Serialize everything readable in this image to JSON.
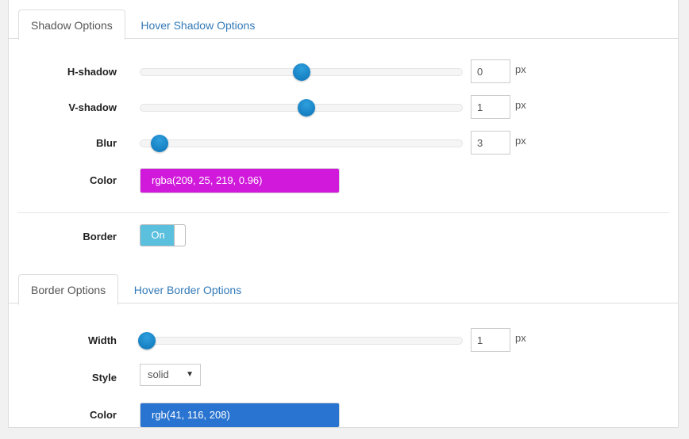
{
  "shadow_section": {
    "tabs": [
      {
        "label": "Shadow Options",
        "active": true
      },
      {
        "label": "Hover Shadow Options",
        "active": false
      }
    ],
    "rows": [
      {
        "label": "H-shadow",
        "type": "slider",
        "value": "0",
        "unit": "px",
        "thumb_percent": 50
      },
      {
        "label": "V-shadow",
        "type": "slider",
        "value": "1",
        "unit": "px",
        "thumb_percent": 51.5
      },
      {
        "label": "Blur",
        "type": "slider",
        "value": "3",
        "unit": "px",
        "thumb_percent": 6
      },
      {
        "label": "Color",
        "type": "color",
        "value": "rgba(209, 25, 219, 0.96)",
        "swatch_color": "#d119db"
      }
    ]
  },
  "border_toggle_row": {
    "label": "Border",
    "state_label": "On",
    "on_color": "#5bc0de"
  },
  "border_section": {
    "tabs": [
      {
        "label": "Border Options",
        "active": true
      },
      {
        "label": "Hover Border Options",
        "active": false
      }
    ],
    "rows": [
      {
        "label": "Width",
        "type": "slider",
        "value": "1",
        "unit": "px",
        "thumb_percent": 2
      },
      {
        "label": "Style",
        "type": "select",
        "value": "solid",
        "caret": "▼"
      },
      {
        "label": "Color",
        "type": "color",
        "value": "rgb(41, 116, 208)",
        "swatch_color": "#2974d0"
      }
    ]
  }
}
